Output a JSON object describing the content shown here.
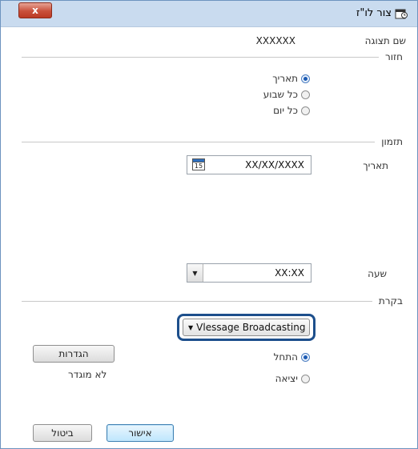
{
  "window": {
    "title": "צור לו\"ז",
    "close_label": "x"
  },
  "display_name": {
    "label": "שם תצוגה",
    "value": "XXXXXX"
  },
  "repeat": {
    "section_label": "חזור",
    "options": [
      {
        "label": "תאריך",
        "selected": true
      },
      {
        "label": "כל שבוע",
        "selected": false
      },
      {
        "label": "כל יום",
        "selected": false
      }
    ]
  },
  "timing": {
    "section_label": "תזמון",
    "date_label": "תאריך",
    "date_value": "XX/XX/XXXX",
    "calendar_day": "15",
    "time_label": "שעה",
    "time_value": "XX:XX"
  },
  "control": {
    "section_label": "בקרת",
    "dropdown_value": "Message Broadcasting",
    "dropdown_visible": "Vlessage Broadcasting",
    "options": [
      {
        "label": "התחל",
        "selected": true
      },
      {
        "label": "יציאה",
        "selected": false
      }
    ],
    "settings_button": "הגדרות",
    "not_set_text": "לא מוגדר"
  },
  "footer": {
    "ok_button": "אישור",
    "cancel_button": "ביטול"
  },
  "colors": {
    "highlight": "#1d4f8c",
    "titlebar": "#c9dbef",
    "close": "#c9503b"
  }
}
